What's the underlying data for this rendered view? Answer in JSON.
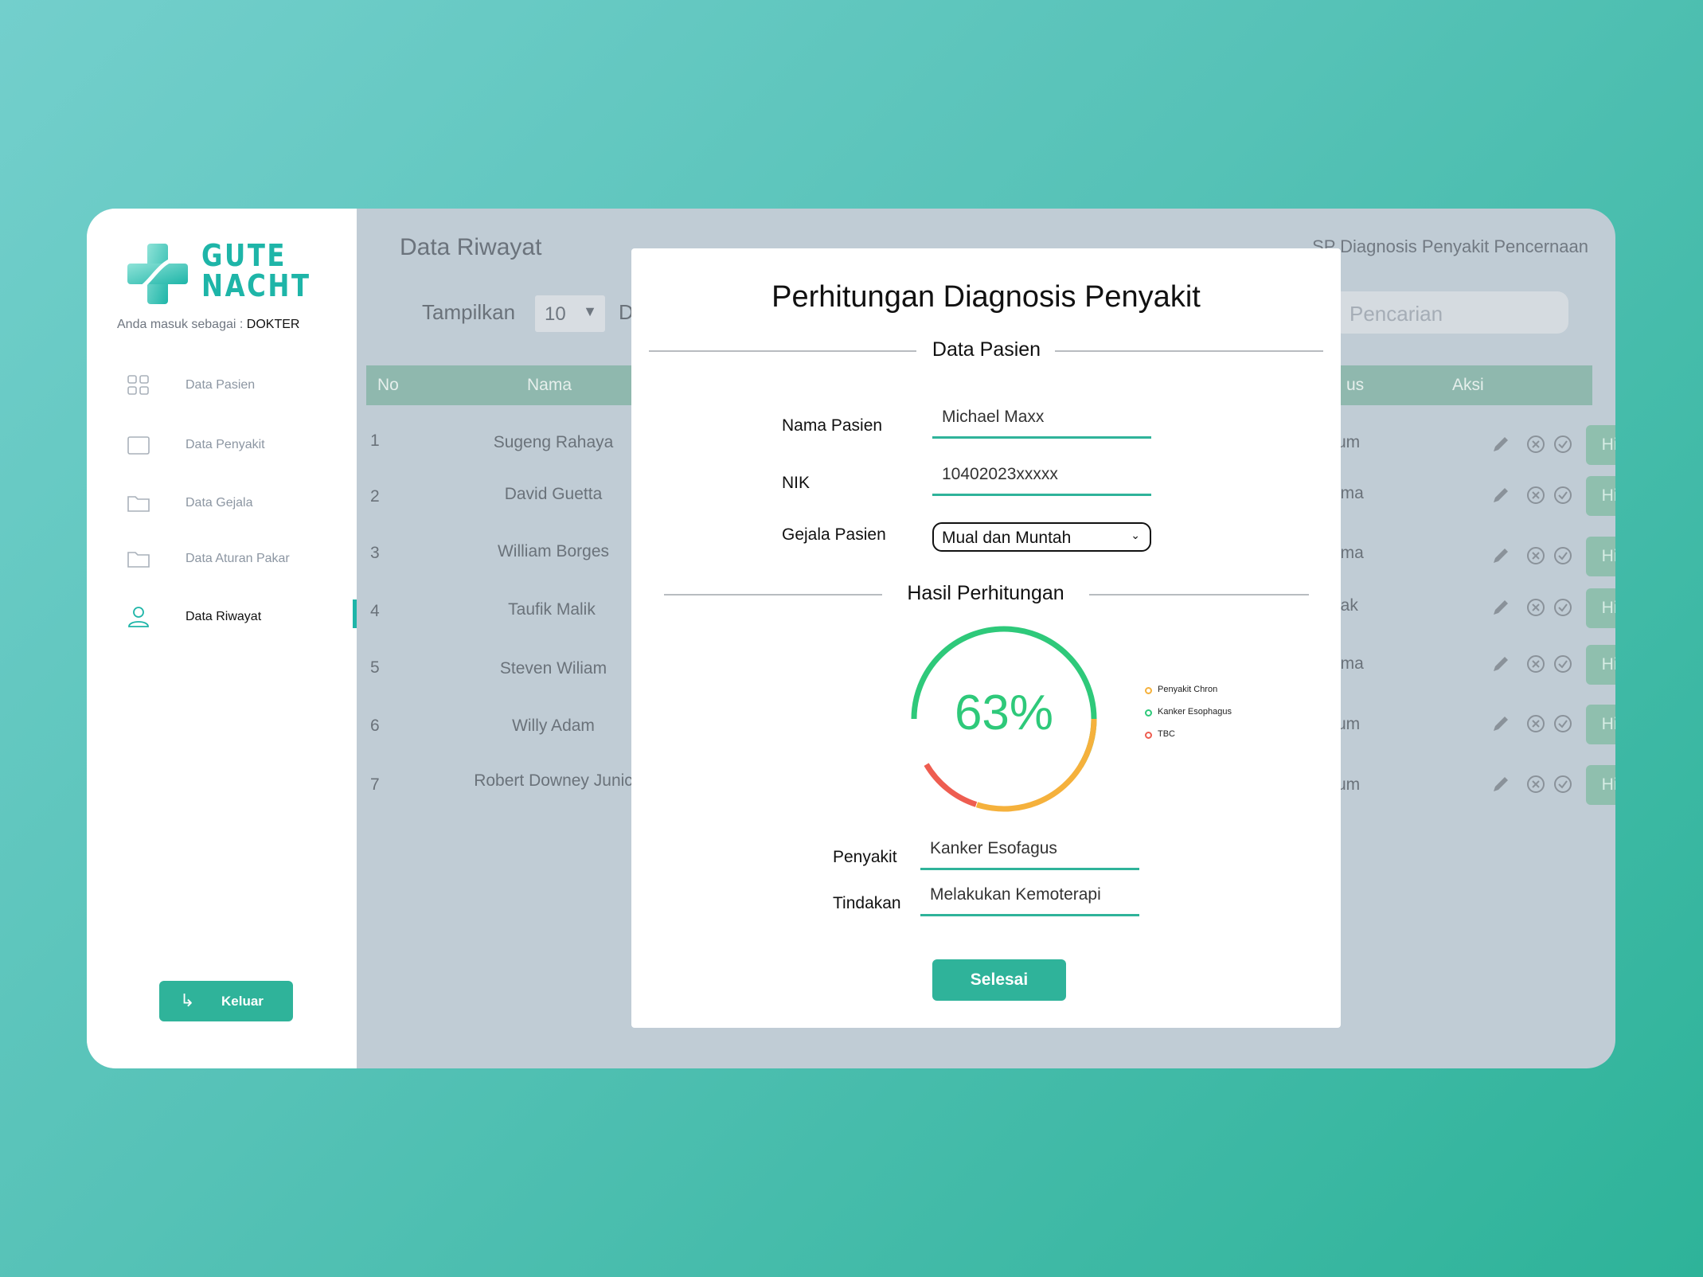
{
  "brand": {
    "name_line1": "GUTE",
    "name_line2": "NACHT",
    "login_prefix": "Anda masuk sebagai : ",
    "role": "DOKTER"
  },
  "sidebar": {
    "items": [
      {
        "label": "Data Pasien",
        "icon": "grid-icon"
      },
      {
        "label": "Data Penyakit",
        "icon": "square-icon"
      },
      {
        "label": "Data Gejala",
        "icon": "folder-icon"
      },
      {
        "label": "Data Aturan Pakar",
        "icon": "folder-icon"
      },
      {
        "label": "Data Riwayat",
        "icon": "user-icon",
        "active": true
      }
    ],
    "logout_label": "Keluar"
  },
  "header": {
    "page_title": "Data Riwayat",
    "app_title": "SP Diagnosis Penyakit Pencernaan"
  },
  "table_controls": {
    "show_label": "Tampilkan",
    "show_value": "10",
    "data_label_truncated": "D",
    "search_placeholder": "Pencarian"
  },
  "table": {
    "columns": {
      "no": "No",
      "nama": "Nama",
      "status_truncated": "us",
      "aksi": "Aksi"
    },
    "rows": [
      {
        "no": "1",
        "nama": "Sugeng Rahaya",
        "status": "um"
      },
      {
        "no": "2",
        "nama": "David Guetta",
        "status": "ima"
      },
      {
        "no": "3",
        "nama": "William Borges",
        "status": "ima"
      },
      {
        "no": "4",
        "nama": "Taufik Malik",
        "status": "lak"
      },
      {
        "no": "5",
        "nama": "Steven Wiliam",
        "status": "ima"
      },
      {
        "no": "6",
        "nama": "Willy Adam",
        "status": "um"
      },
      {
        "no": "7",
        "nama": "Robert Downey Junic",
        "status": "um"
      }
    ],
    "action_label": "Hitung"
  },
  "modal": {
    "title": "Perhitungan Diagnosis Penyakit",
    "section_patient": "Data Pasien",
    "fields": {
      "name_label": "Nama Pasien",
      "name_value": "Michael Maxx",
      "nik_label": "NIK",
      "nik_value": "10402023xxxxx",
      "symptom_label": "Gejala Pasien",
      "symptom_value": "Mual dan Muntah"
    },
    "section_result": "Hasil Perhitungan",
    "gauge": {
      "value_text": "63%",
      "value": 63
    },
    "legend": [
      {
        "label": "Penyakit Chron",
        "color": "#f5b13c"
      },
      {
        "label": "Kanker Esophagus",
        "color": "#2ec97a"
      },
      {
        "label": "TBC",
        "color": "#ee5d50"
      }
    ],
    "result": {
      "disease_label": "Penyakit",
      "disease_value": "Kanker Esofagus",
      "action_label": "Tindakan",
      "action_value": "Melakukan Kemoterapi"
    },
    "done_label": "Selesai"
  },
  "colors": {
    "accent": "#2fb39a",
    "brand": "#1eb5a8"
  }
}
